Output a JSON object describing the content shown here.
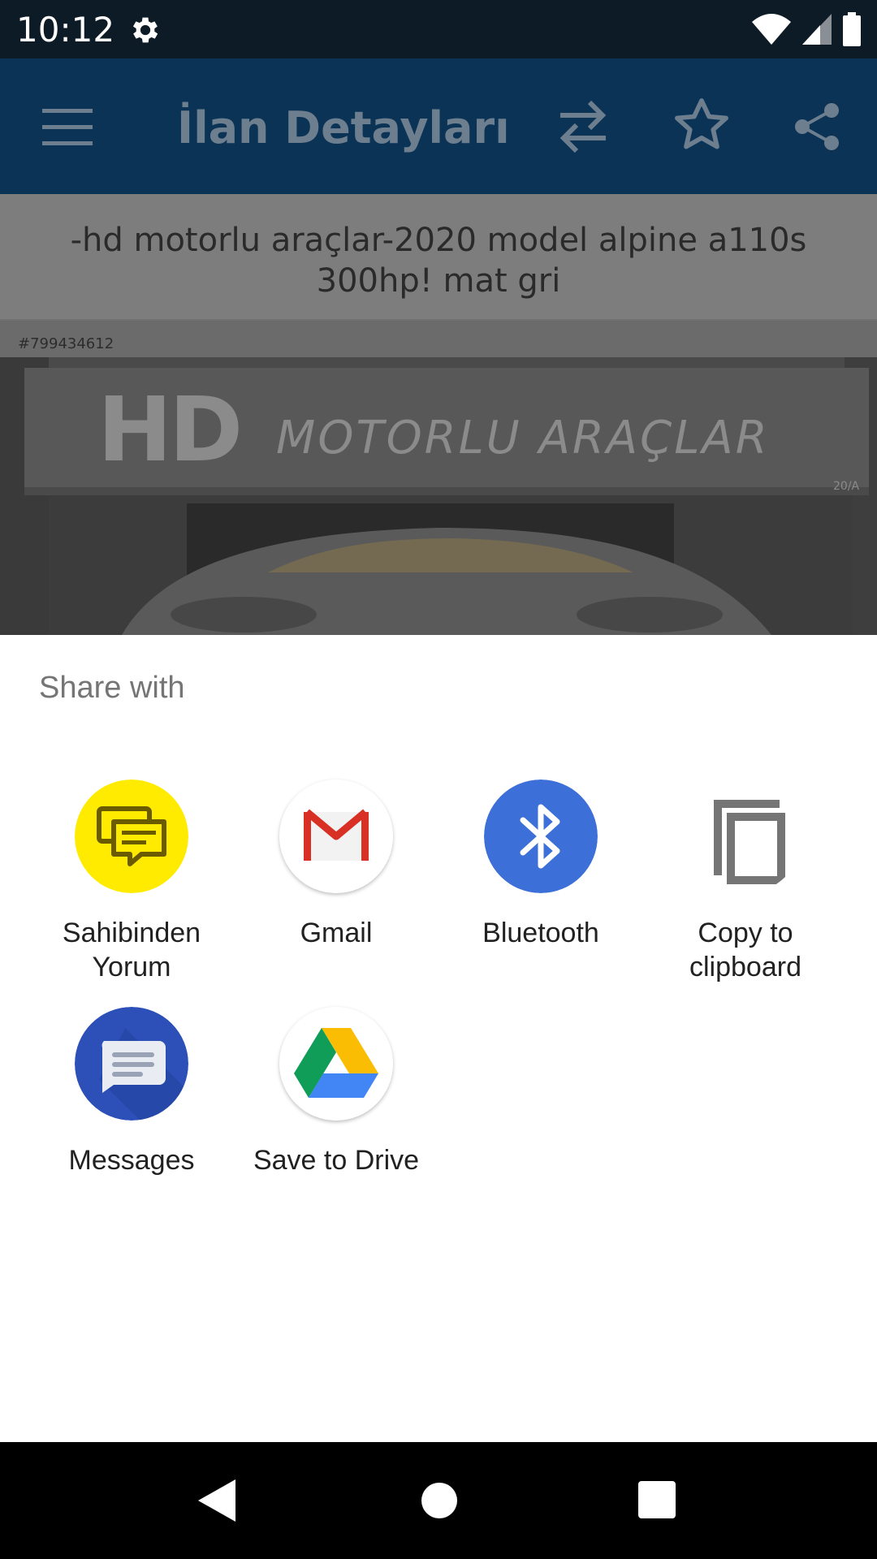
{
  "status_bar": {
    "time": "10:12"
  },
  "app_bar": {
    "title": "İlan Detayları"
  },
  "listing": {
    "title": "-hd motorlu araçlar-2020 model alpine a110s 300hp! mat gri",
    "photo_id": "#799434612",
    "sign_big": "HD",
    "sign_text": "MOTORLU ARAÇLAR",
    "door_number": "20/A"
  },
  "share_sheet": {
    "title": "Share with",
    "targets": [
      {
        "label": "Sahibinden Yorum",
        "icon": "chat-bubbles-icon",
        "color": "#ffeb00"
      },
      {
        "label": "Gmail",
        "icon": "gmail-icon",
        "color": "#ffffff"
      },
      {
        "label": "Bluetooth",
        "icon": "bluetooth-icon",
        "color": "#3c6fd8"
      },
      {
        "label": "Copy to clipboard",
        "icon": "copy-icon",
        "color": "#ffffff"
      },
      {
        "label": "Messages",
        "icon": "messages-icon",
        "color": "#2c50b8"
      },
      {
        "label": "Save to Drive",
        "icon": "drive-icon",
        "color": "#ffffff"
      }
    ]
  },
  "colors": {
    "status_bar": "#0d1b26",
    "app_bar_dimmed": "#0b3356",
    "sheet_background": "#ffffff"
  }
}
